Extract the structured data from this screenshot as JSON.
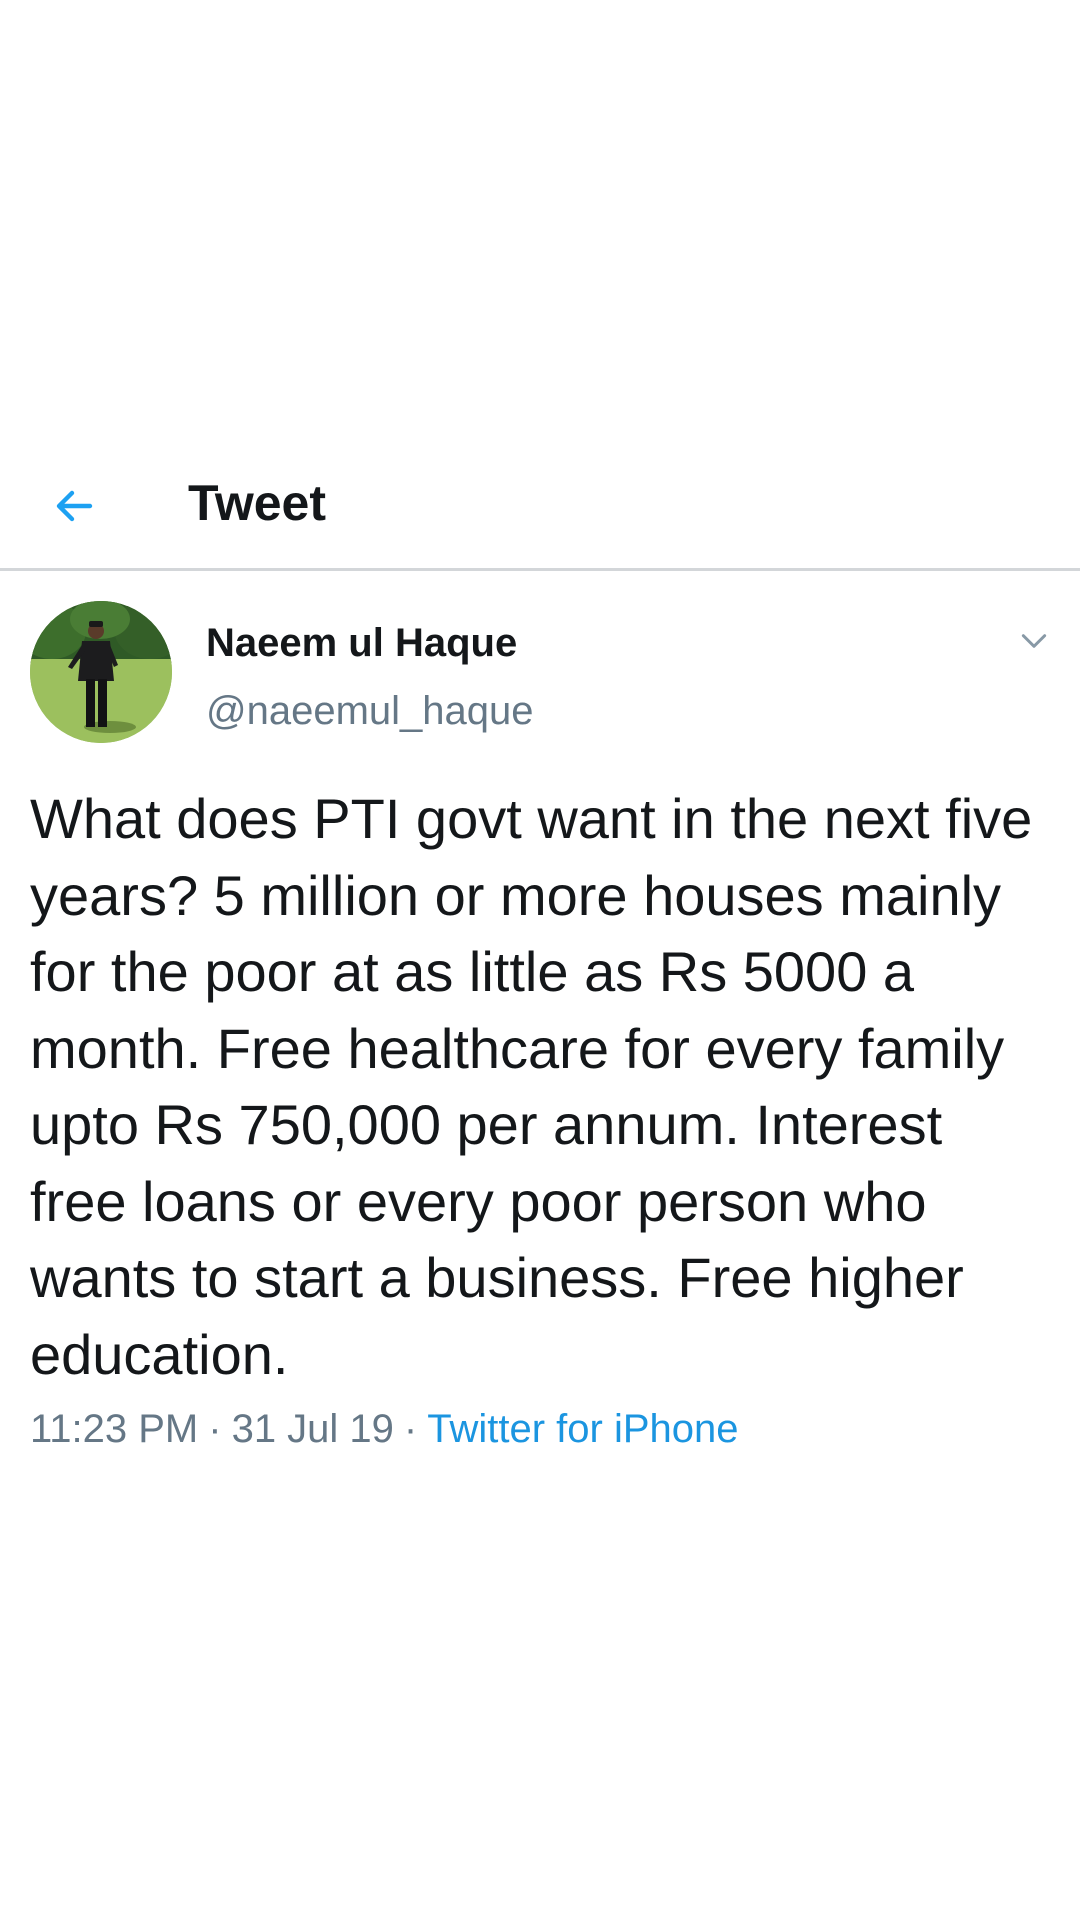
{
  "header": {
    "title": "Tweet",
    "back_icon": "arrow-left-icon",
    "accent_color": "#1da1f2"
  },
  "tweet": {
    "author": {
      "name": "Naeem ul Haque",
      "handle": "@naeemul_haque",
      "avatar": "profile-photo-man-standing-on-grass"
    },
    "menu_icon": "chevron-down-icon",
    "text": "What does PTI govt want in the next five years? 5 million or more houses mainly for the poor at as little as Rs 5000 a month. Free healthcare for every family upto Rs 750,000 per annum. Interest free loans or every poor person who wants to start a business. Free higher education.",
    "meta": {
      "time": "11:23 PM",
      "separator": "·",
      "date": "31 Jul 19",
      "source": "Twitter for iPhone",
      "source_color": "#1b95e0",
      "muted_color": "#657786"
    }
  }
}
